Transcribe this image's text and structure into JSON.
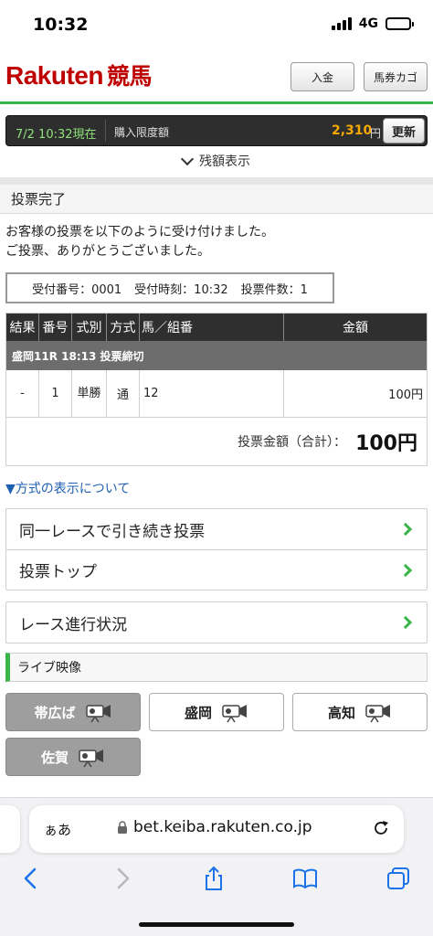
{
  "status_bar": {
    "time": "10:32",
    "network": "4G"
  },
  "header": {
    "logo_text": "Rakuten",
    "logo_sub": "競馬",
    "deposit_label": "入金",
    "cart_label": "馬券カゴ"
  },
  "info_bar": {
    "datetime": "7/2 10:32現在",
    "limit_label": "購入限度額",
    "limit_amount": "2,310",
    "unit": "円",
    "refresh_label": "更新"
  },
  "balance_toggle": "残額表示",
  "section_title": "投票完了",
  "message": {
    "line1": "お客様の投票を以下のように受け付けました。",
    "line2": "ご投票、ありがとうございました。"
  },
  "receipt": {
    "number": "受付番号：0001",
    "time": "受付時刻：10:32",
    "count": "投票件数：1"
  },
  "table": {
    "headers": [
      "結果",
      "番号",
      "式別",
      "方式",
      "馬／組番",
      "金額"
    ],
    "race_label": "盛岡11R 18:13 投票締切",
    "rows": [
      {
        "result": "-",
        "number": "1",
        "type": "単勝",
        "method": "通",
        "combo": "12",
        "amount": "100円"
      }
    ],
    "total_label": "投票金額（合計）：",
    "total_amount": "100円"
  },
  "method_link": "▼方式の表示について",
  "nav": {
    "continue_label": "同一レースで引き続き投票",
    "top_label": "投票トップ",
    "progress_label": "レース進行状況"
  },
  "live": {
    "title": "ライブ映像",
    "venues": [
      {
        "name": "帯広ば",
        "active": false
      },
      {
        "name": "盛岡",
        "active": true
      },
      {
        "name": "高知",
        "active": true
      },
      {
        "name": "佐賀",
        "active": false
      }
    ]
  },
  "browser": {
    "aa": "ぁあ",
    "url": "bet.keiba.rakuten.co.jp"
  },
  "colors": {
    "brand_red": "#bf0000",
    "accent_green": "#3ab54a",
    "amount_orange": "#f6a800",
    "link_blue": "#1e5fb3"
  },
  "icons": [
    "signal-icon",
    "battery-icon",
    "chevron-down-icon",
    "chevron-right-icon",
    "camera-icon",
    "lock-icon",
    "reload-icon",
    "back-icon",
    "forward-icon",
    "share-icon",
    "bookmarks-icon",
    "tabs-icon"
  ]
}
